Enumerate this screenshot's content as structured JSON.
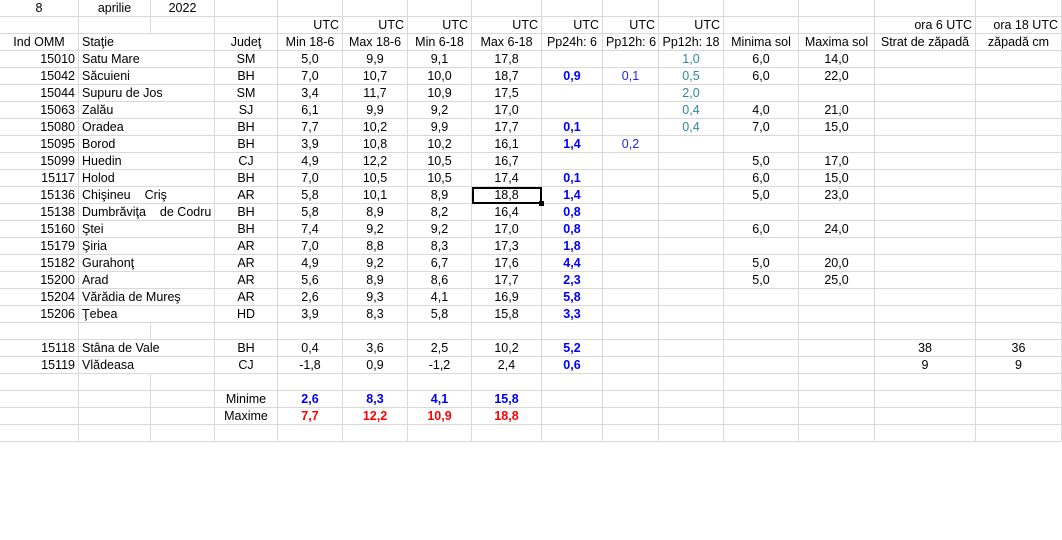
{
  "header": {
    "day": "8",
    "month": "aprilie",
    "year": "2022"
  },
  "utc_row": [
    "UTC",
    "UTC",
    "UTC",
    "UTC",
    "UTC",
    "UTC",
    "UTC",
    "",
    "",
    "ora 6 UTC",
    "ora 18 UTC"
  ],
  "columns": [
    "Ind OMM",
    "Staţie",
    "Judeţ",
    "Min 18-6",
    "Max 18-6",
    "Min 6-18",
    "Max 6-18",
    "Pp24h: 6",
    "Pp12h: 6",
    "Pp12h: 18",
    "Minima sol",
    "Maxima sol",
    "Strat de zăpadă",
    "zăpadă cm"
  ],
  "rows": [
    [
      "15010",
      "Satu Mare",
      "",
      "SM",
      "5,0",
      "9,9",
      "9,1",
      "17,8",
      "",
      "",
      "1,0",
      "6,0",
      "14,0",
      "",
      ""
    ],
    [
      "15042",
      "Săcuieni",
      "",
      "BH",
      "7,0",
      "10,7",
      "10,0",
      "18,7",
      "0,9",
      "0,1",
      "0,5",
      "6,0",
      "22,0",
      "",
      ""
    ],
    [
      "15044",
      "Supuru de Jos",
      "",
      "SM",
      "3,4",
      "11,7",
      "10,9",
      "17,5",
      "",
      "",
      "2,0",
      "",
      "",
      "",
      ""
    ],
    [
      "15063",
      "Zalău",
      "",
      "SJ",
      "6,1",
      "9,9",
      "9,2",
      "17,0",
      "",
      "",
      "0,4",
      "4,0",
      "21,0",
      "",
      ""
    ],
    [
      "15080",
      "Oradea",
      "",
      "BH",
      "7,7",
      "10,2",
      "9,9",
      "17,7",
      "0,1",
      "",
      "0,4",
      "7,0",
      "15,0",
      "",
      ""
    ],
    [
      "15095",
      "Borod",
      "",
      "BH",
      "3,9",
      "10,8",
      "10,2",
      "16,1",
      "1,4",
      "0,2",
      "",
      "",
      "",
      "",
      ""
    ],
    [
      "15099",
      "Huedin",
      "",
      "CJ",
      "4,9",
      "12,2",
      "10,5",
      "16,7",
      "",
      "",
      "",
      "5,0",
      "17,0",
      "",
      ""
    ],
    [
      "15117",
      "Holod",
      "",
      "BH",
      "7,0",
      "10,5",
      "10,5",
      "17,4",
      "0,1",
      "",
      "",
      "6,0",
      "15,0",
      "",
      ""
    ],
    [
      "15136",
      "Chişineu",
      "Criş",
      "AR",
      "5,8",
      "10,1",
      "8,9",
      "18,8",
      "1,4",
      "",
      "",
      "5,0",
      "23,0",
      "",
      ""
    ],
    [
      "15138",
      "Dumbrăviţa",
      "de Codru",
      "BH",
      "5,8",
      "8,9",
      "8,2",
      "16,4",
      "0,8",
      "",
      "",
      "",
      "",
      "",
      ""
    ],
    [
      "15160",
      "Ştei",
      "",
      "BH",
      "7,4",
      "9,2",
      "9,2",
      "17,0",
      "0,8",
      "",
      "",
      "6,0",
      "24,0",
      "",
      ""
    ],
    [
      "15179",
      "Şiria",
      "",
      "AR",
      "7,0",
      "8,8",
      "8,3",
      "17,3",
      "1,8",
      "",
      "",
      "",
      "",
      "",
      ""
    ],
    [
      "15182",
      "Gurahonţ",
      "",
      "AR",
      "4,9",
      "9,2",
      "6,7",
      "17,6",
      "4,4",
      "",
      "",
      "5,0",
      "20,0",
      "",
      ""
    ],
    [
      "15200",
      "Arad",
      "",
      "AR",
      "5,6",
      "8,9",
      "8,6",
      "17,7",
      "2,3",
      "",
      "",
      "5,0",
      "25,0",
      "",
      ""
    ],
    [
      "15204",
      "Vărădia de Mureş",
      "",
      "AR",
      "2,6",
      "9,3",
      "4,1",
      "16,9",
      "5,8",
      "",
      "",
      "",
      "",
      "",
      ""
    ],
    [
      "15206",
      "Ţebea",
      "",
      "HD",
      "3,9",
      "8,3",
      "5,8",
      "15,8",
      "3,3",
      "",
      "",
      "",
      "",
      "",
      ""
    ]
  ],
  "mountain_rows": [
    [
      "15118",
      "Stâna de Vale",
      "",
      "BH",
      "0,4",
      "3,6",
      "2,5",
      "10,2",
      "5,2",
      "",
      "",
      "",
      "",
      "38",
      "36"
    ],
    [
      "15119",
      "Vlădeasa",
      "",
      "CJ",
      "-1,8",
      "0,9",
      "-1,2",
      "2,4",
      "0,6",
      "",
      "",
      "",
      "",
      "9",
      "9"
    ]
  ],
  "summary": {
    "minime_label": "Minime",
    "maxime_label": "Maxime",
    "minime": [
      "2,6",
      "8,3",
      "4,1",
      "15,8"
    ],
    "maxime": [
      "7,7",
      "12,2",
      "10,9",
      "18,8"
    ]
  }
}
